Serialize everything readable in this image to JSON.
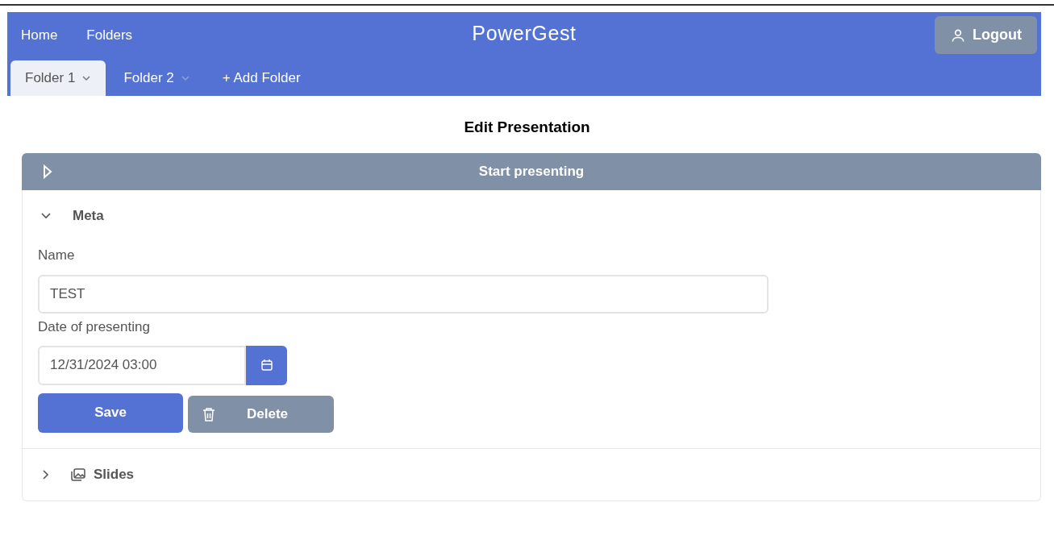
{
  "navbar": {
    "links": [
      "Home",
      "Folders"
    ],
    "title": "PowerGest",
    "logout": "Logout"
  },
  "folder_tabs": [
    {
      "label": "Folder 1",
      "selected": true
    },
    {
      "label": "Folder 2",
      "selected": false
    }
  ],
  "add_folder": "+ Add Folder",
  "heading": "Edit Presentation",
  "start_presenting": "Start presenting",
  "sections": [
    {
      "kind": "form",
      "title": "Meta",
      "expanded": true,
      "fields": [
        {
          "label": "Name",
          "value": "TEST",
          "kind": "text"
        },
        {
          "label": "Date of presenting",
          "value": "12/31/2024 03:00",
          "kind": "date"
        }
      ],
      "save": "Save",
      "delete": "Delete"
    },
    {
      "kind": "gallery",
      "title": "Slides",
      "expanded": false
    }
  ]
}
